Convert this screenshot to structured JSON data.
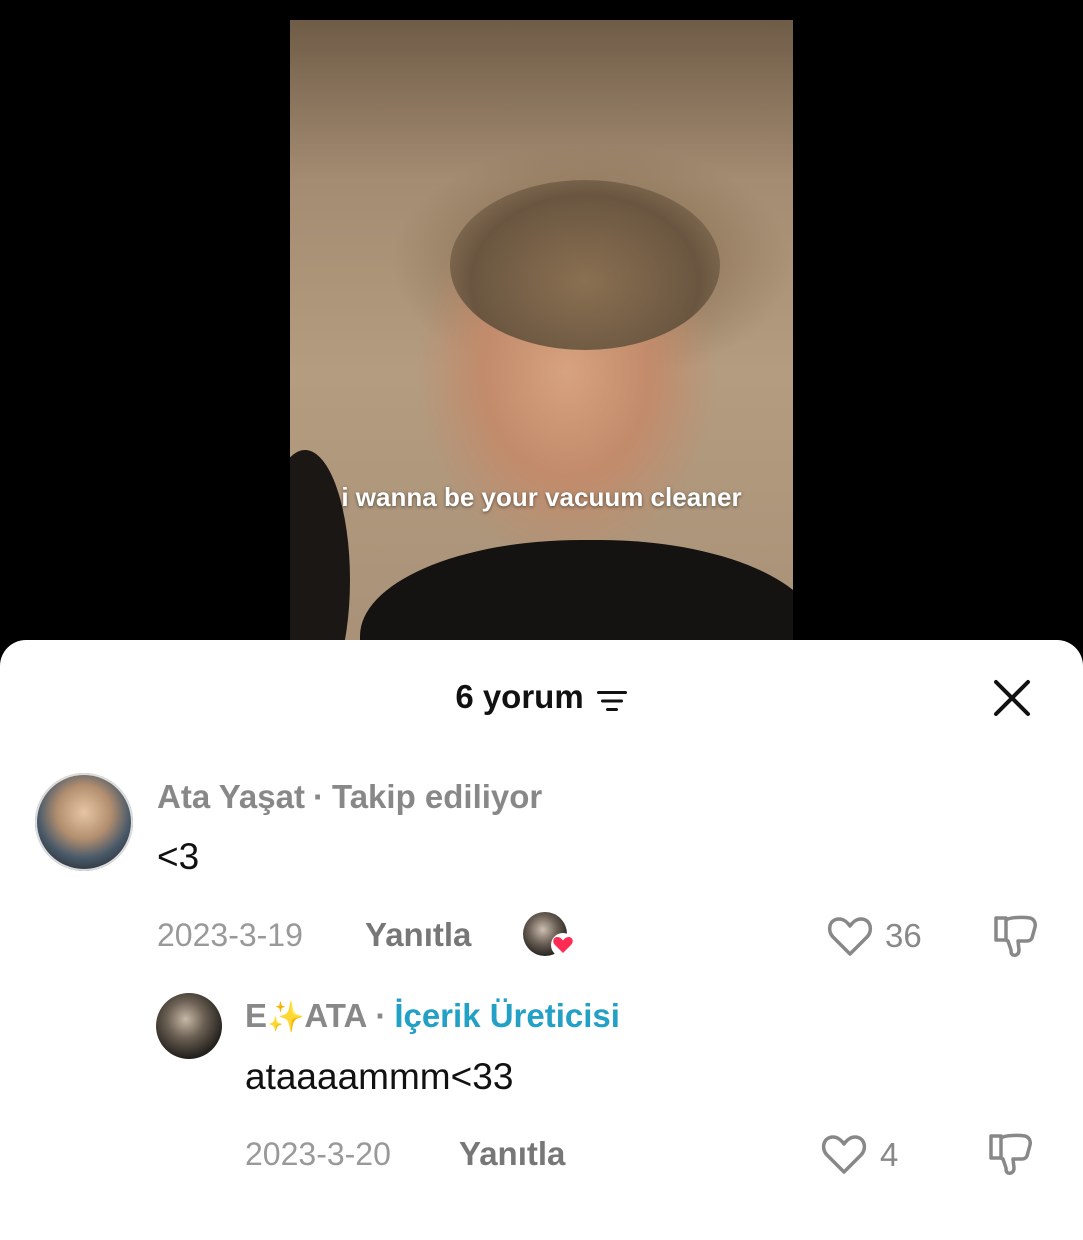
{
  "video": {
    "caption": "i wanna be your vacuum cleaner"
  },
  "comments_panel": {
    "title": "6 yorum",
    "sort_icon": "sort-lines-icon",
    "close_icon": "close-icon"
  },
  "comments": [
    {
      "author": "Ata Yaşat",
      "author_tag": "Takip ediliyor",
      "text": "<3",
      "date": "2023-3-19",
      "reply_label": "Yanıtla",
      "likes": "36",
      "liked_by_creator": true
    },
    {
      "author_prefix": "E",
      "author_sparkle": "✨",
      "author_suffix": "ATA",
      "author_tag": "İçerik Üreticisi",
      "text": "ataaaammm<33",
      "date": "2023-3-20",
      "reply_label": "Yanıtla",
      "likes": "4"
    }
  ],
  "colors": {
    "creator_tag": "#23a0c6",
    "heart_badge": "#fe2c55"
  }
}
